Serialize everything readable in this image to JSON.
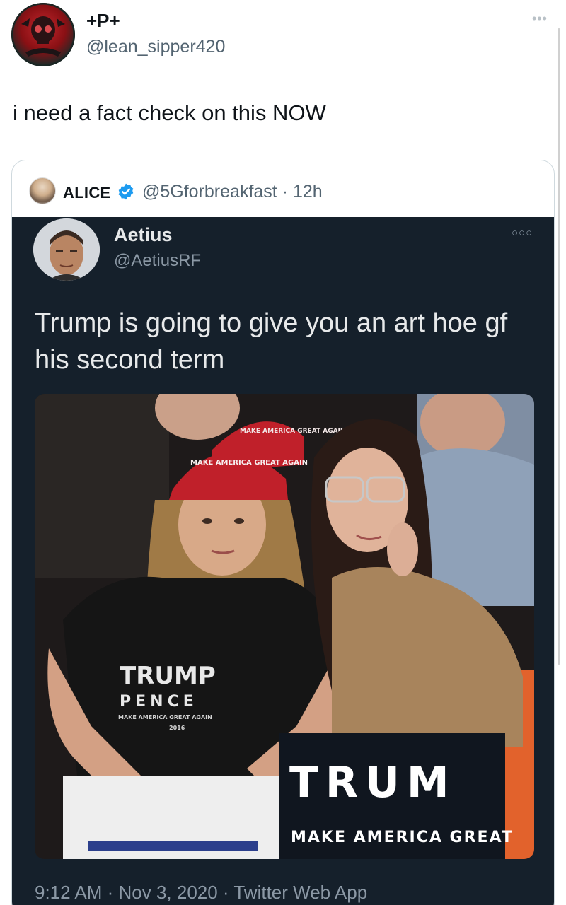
{
  "outer_tweet": {
    "display_name": "+P+",
    "handle": "@lean_sipper420",
    "more_icon": "more-horizontal-icon",
    "text": "i need a fact check on this NOW"
  },
  "quoted_tweet": {
    "display_name": "ALICE",
    "verified_icon": "verified-badge-icon",
    "handle_time": "@5Gforbreakfast · 12h"
  },
  "embedded_screenshot": {
    "display_name": "Aetius",
    "handle": "@AetiusRF",
    "text": "Trump is going to give you an art hoe gf his second term",
    "meta": "9:12 AM · Nov 3, 2020 · Twitter Web App",
    "photo": {
      "cap_back_text": "MAKE AMERICA GREAT AGAIN",
      "cap_front_text": "MAKE AMERICA GREAT AGAIN",
      "shirt_line1": "TRUMP",
      "shirt_line2": "PENCE",
      "shirt_line3": "MAKE AMERICA GREAT AGAIN",
      "shirt_line4": "2016",
      "sign_main": "TRUM",
      "sign_sub": "MAKE AMERICA GREAT"
    }
  },
  "colors": {
    "link_gray": "#536471",
    "dark_bg": "#15202b",
    "verified_blue": "#1d9bf0",
    "maga_red": "#c0202a"
  }
}
